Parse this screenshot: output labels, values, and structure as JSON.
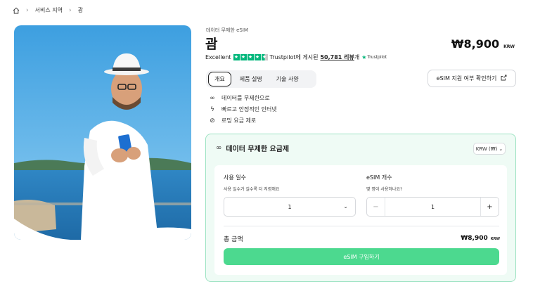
{
  "breadcrumb": {
    "items": [
      "서비스 지역",
      "괌"
    ]
  },
  "product": {
    "kicker": "데이터 무제한 eSIM",
    "title": "괌",
    "price": "₩8,900",
    "currency": "KRW"
  },
  "rating": {
    "label": "Excellent",
    "stars": 4.5,
    "source": "Trustpilot",
    "posted_text": "에 게시된",
    "review_count": "50,781 리뷰",
    "suffix": "개",
    "badge": "Trustpilot"
  },
  "tabs": [
    "개요",
    "제품 설명",
    "기술 사양"
  ],
  "check_button": {
    "label": "eSIM 지원 여부 확인하기",
    "icon": "external-link-icon"
  },
  "features": [
    {
      "icon": "infinity-icon",
      "label": "데이터를 무제한으로"
    },
    {
      "icon": "lightning-icon",
      "label": "빠르고 안정적인 인터넷"
    },
    {
      "icon": "no-roaming-icon",
      "label": "로밍 요금 제로"
    }
  ],
  "plan": {
    "heading": "데이터 무제한 요금제",
    "currency_select": "KRW (₩)",
    "days_label": "사용 일수",
    "days_hint": "사용 일수가 길수록 더 저렴해요",
    "days_value": "1",
    "count_label": "eSIM 개수",
    "count_hint": "몇 명이 사용하나요?",
    "count_value": "1",
    "minus": "−",
    "plus": "+",
    "total_label": "총 금액",
    "total_price": "₩8,900",
    "total_currency": "KRW",
    "buy_label": "eSIM 구입하기"
  },
  "colors": {
    "accent": "#4cd98f",
    "trustpilot": "#00b67a",
    "card_bg": "#effbf5",
    "card_border": "#9ee3c3"
  }
}
